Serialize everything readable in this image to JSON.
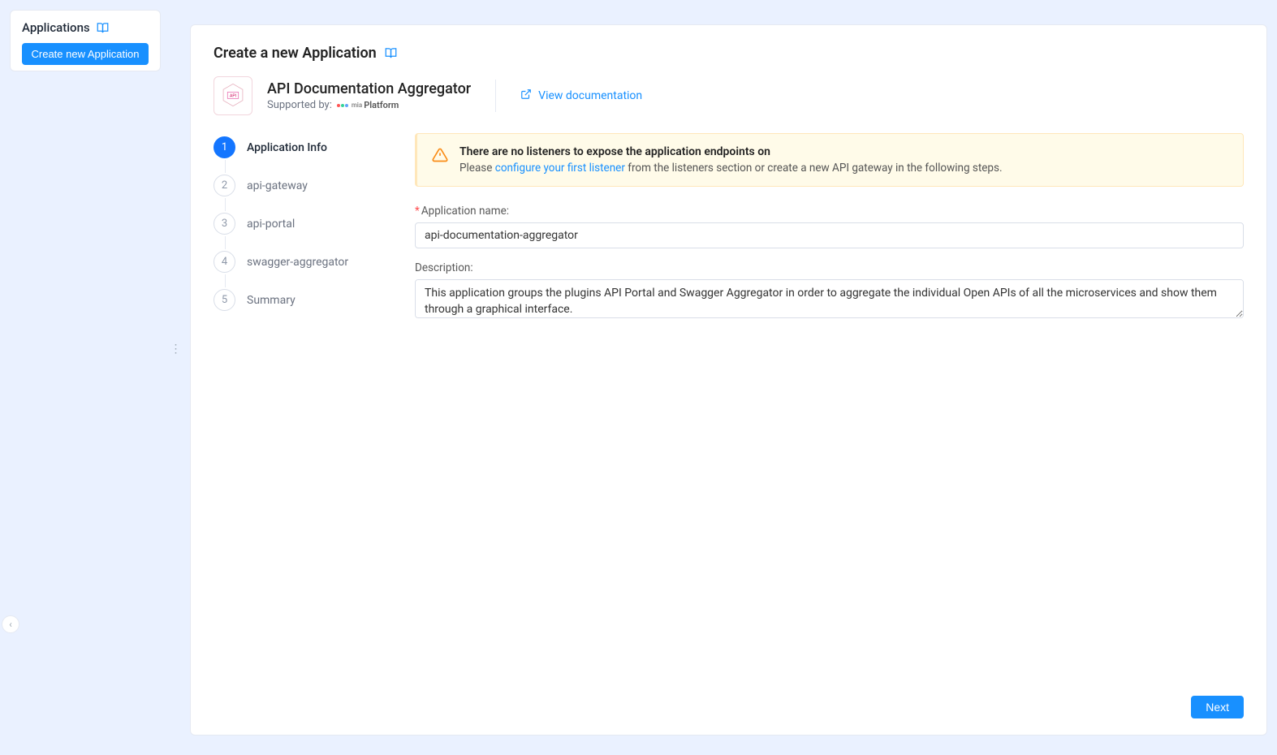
{
  "sidebar": {
    "title": "Applications",
    "create_label": "Create new Application"
  },
  "page": {
    "title": "Create a new Application"
  },
  "app": {
    "name": "API Documentation Aggregator",
    "supported_by_label": "Supported by:",
    "platform_name": "Platform",
    "doc_link_label": "View documentation"
  },
  "steps": [
    {
      "num": "1",
      "label": "Application Info",
      "active": true
    },
    {
      "num": "2",
      "label": "api-gateway",
      "active": false
    },
    {
      "num": "3",
      "label": "api-portal",
      "active": false
    },
    {
      "num": "4",
      "label": "swagger-aggregator",
      "active": false
    },
    {
      "num": "5",
      "label": "Summary",
      "active": false
    }
  ],
  "alert": {
    "title": "There are no listeners to expose the application endpoints on",
    "msg_prefix": "Please ",
    "link_text": "configure your first listener",
    "msg_suffix": " from the listeners section or create a new API gateway in the following steps."
  },
  "form": {
    "name_label": "Application name:",
    "name_value": "api-documentation-aggregator",
    "desc_label": "Description:",
    "desc_value": "This application groups the plugins API Portal and Swagger Aggregator in order to aggregate the individual Open APIs of all the microservices and show them through a graphical interface."
  },
  "footer": {
    "next_label": "Next"
  }
}
